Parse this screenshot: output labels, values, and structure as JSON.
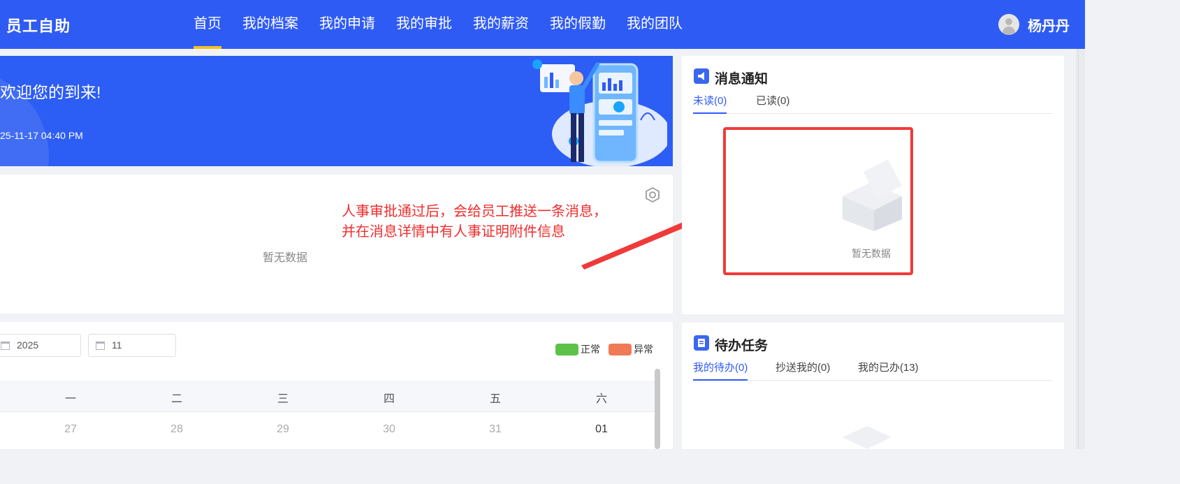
{
  "header": {
    "brand": "员工自助",
    "nav": [
      "首页",
      "我的档案",
      "我的申请",
      "我的审批",
      "我的薪资",
      "我的假勤",
      "我的团队"
    ],
    "active_nav": "首页",
    "user_name": "杨丹丹"
  },
  "banner": {
    "welcome": "欢迎您的到来!",
    "datetime": "25-11-17 04:40 PM"
  },
  "middle": {
    "empty_text": "暂无数据"
  },
  "annotation": {
    "line1": "人事审批通过后，会给员工推送一条消息，",
    "line2": "并在消息详情中有人事证明附件信息",
    "color": "#f02d2d"
  },
  "calendar": {
    "year": "2025",
    "month": "11",
    "legend": [
      {
        "label": "正常",
        "color": "#5cc24a"
      },
      {
        "label": "异常",
        "color": "#f07a55"
      }
    ],
    "weekdays": [
      "一",
      "二",
      "三",
      "四",
      "五",
      "六"
    ],
    "days": [
      "27",
      "28",
      "29",
      "30",
      "31",
      "01"
    ]
  },
  "notice": {
    "title": "消息通知",
    "tabs": [
      "未读(0)",
      "已读(0)"
    ],
    "empty_text": "暂无数据"
  },
  "tasks": {
    "title": "待办任务",
    "tabs": [
      "我的待办(0)",
      "抄送我的(0)",
      "我的已办(13)"
    ]
  },
  "colors": {
    "primary": "#2f5bf5",
    "active_underline": "#f5c021",
    "highlight_box": "#f03a3a"
  }
}
